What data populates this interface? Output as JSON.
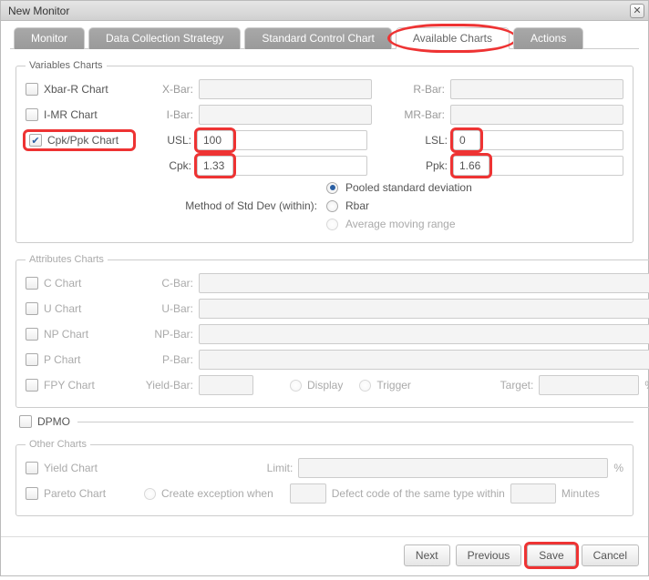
{
  "window": {
    "title": "New Monitor"
  },
  "tabs": {
    "monitor": "Monitor",
    "data_collection": "Data Collection Strategy",
    "std_control": "Standard Control Chart",
    "available": "Available Charts",
    "actions": "Actions"
  },
  "variables": {
    "legend": "Variables Charts",
    "xbar_r": "Xbar-R Chart",
    "imr": "I-MR Chart",
    "cpkppk": "Cpk/Ppk Chart",
    "xbar_lbl": "X-Bar:",
    "ibar_lbl": "I-Bar:",
    "rbar_lbl": "R-Bar:",
    "mrbar_lbl": "MR-Bar:",
    "usl_lbl": "USL:",
    "lsl_lbl": "LSL:",
    "cpk_lbl": "Cpk:",
    "ppk_lbl": "Ppk:",
    "usl_val": "100",
    "lsl_val": "0",
    "cpk_val": "1.33",
    "ppk_val": "1.66",
    "method_lbl": "Method of Std Dev (within):",
    "opt_pooled": "Pooled standard deviation",
    "opt_rbar": "Rbar",
    "opt_amr": "Average moving range"
  },
  "attributes": {
    "legend": "Attributes Charts",
    "c": "C Chart",
    "c_lbl": "C-Bar:",
    "u": "U Chart",
    "u_lbl": "U-Bar:",
    "np": "NP Chart",
    "np_lbl": "NP-Bar:",
    "p": "P Chart",
    "p_lbl": "P-Bar:",
    "fpy": "FPY Chart",
    "fpy_lbl": "Yield-Bar:",
    "display": "Display",
    "trigger": "Trigger",
    "target": "Target:",
    "pct": "%"
  },
  "dpmo": {
    "label": "DPMO"
  },
  "other": {
    "legend": "Other Charts",
    "yield": "Yield Chart",
    "pareto": "Pareto Chart",
    "limit": "Limit:",
    "pct": "%",
    "exc_when": "Create exception when",
    "exc_mid": "Defect code of the same type within",
    "exc_unit": "Minutes"
  },
  "buttons": {
    "next": "Next",
    "prev": "Previous",
    "save": "Save",
    "cancel": "Cancel"
  }
}
